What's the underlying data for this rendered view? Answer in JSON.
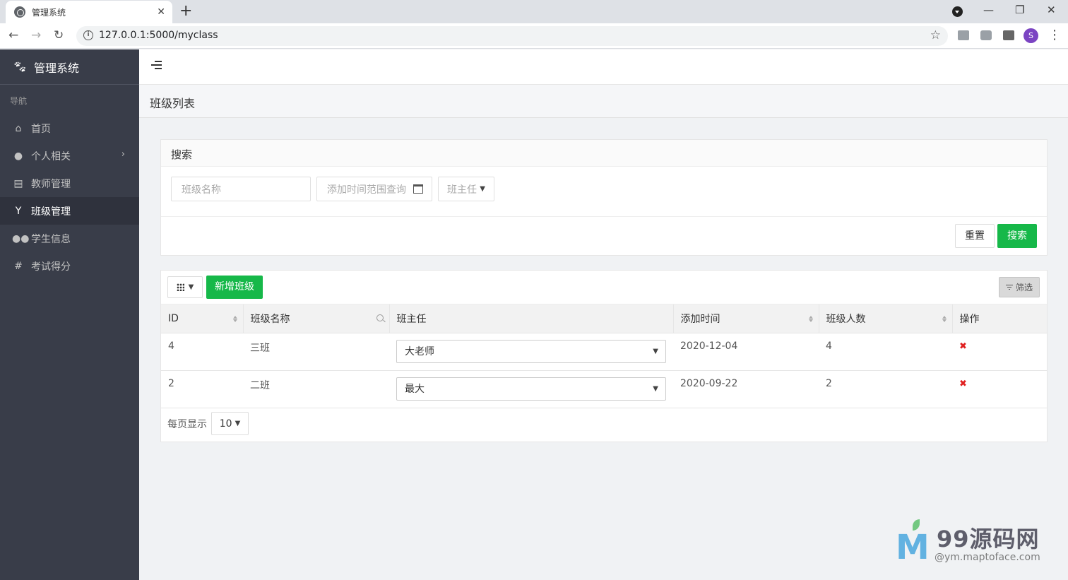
{
  "browser": {
    "tab_title": "管理系统",
    "url": "127.0.0.1:5000/myclass",
    "avatar_letter": "S"
  },
  "sidebar": {
    "brand": "管理系统",
    "nav_header": "导航",
    "items": [
      {
        "label": "首页",
        "icon": "home-icon"
      },
      {
        "label": "个人相关",
        "icon": "user-icon"
      },
      {
        "label": "教师管理",
        "icon": "list-icon"
      },
      {
        "label": "班级管理",
        "icon": "glass-icon",
        "active": true
      },
      {
        "label": "学生信息",
        "icon": "users-icon"
      },
      {
        "label": "考试得分",
        "icon": "hash-icon"
      }
    ]
  },
  "page": {
    "title": "班级列表"
  },
  "search": {
    "title": "搜索",
    "name_placeholder": "班级名称",
    "date_placeholder": "添加时间范围查询",
    "teacher_placeholder": "班主任",
    "reset_label": "重置",
    "search_label": "搜索"
  },
  "table": {
    "add_label": "新增班级",
    "filter_label": "筛选",
    "headers": [
      "ID",
      "班级名称",
      "班主任",
      "添加时间",
      "班级人数",
      "操作"
    ],
    "rows": [
      {
        "id": "4",
        "name": "三班",
        "teacher": "大老师",
        "added": "2020-12-04",
        "count": "4"
      },
      {
        "id": "2",
        "name": "二班",
        "teacher": "最大",
        "added": "2020-09-22",
        "count": "2"
      }
    ],
    "page_size_label": "每页显示",
    "page_size": "10"
  },
  "watermark": {
    "brand": "99源码网",
    "sub": "@ym.maptoface.com"
  },
  "colors": {
    "sidebar_bg": "#393d49",
    "accent_green": "#16b849",
    "delete_red": "#e02020"
  }
}
